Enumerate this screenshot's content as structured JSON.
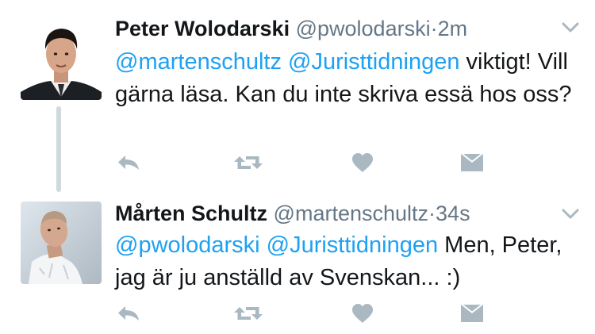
{
  "tweets": [
    {
      "name": "Peter Wolodarski",
      "handle": "@pwolodarski",
      "separator": "·",
      "time": "2m",
      "mentions": [
        "@martenschultz",
        "@Juristtidningen"
      ],
      "text": "viktigt! Vill gärna läsa. Kan du inte skriva essä hos oss?"
    },
    {
      "name": "Mårten Schultz",
      "handle": "@martenschultz",
      "separator": "·",
      "time": "34s",
      "mentions": [
        "@pwolodarski",
        "@Juristtidningen"
      ],
      "text": "Men, Peter, jag är ju anställd av Svenskan... :)"
    }
  ],
  "icons": {
    "reply": "reply-icon",
    "retweet": "retweet-icon",
    "like": "heart-icon",
    "dm": "envelope-icon",
    "menu": "chevron-down-icon"
  },
  "colors": {
    "mention": "#1da1f2",
    "meta": "#657786",
    "icon": "#aab8c2",
    "thread_line": "#cfd9de"
  }
}
